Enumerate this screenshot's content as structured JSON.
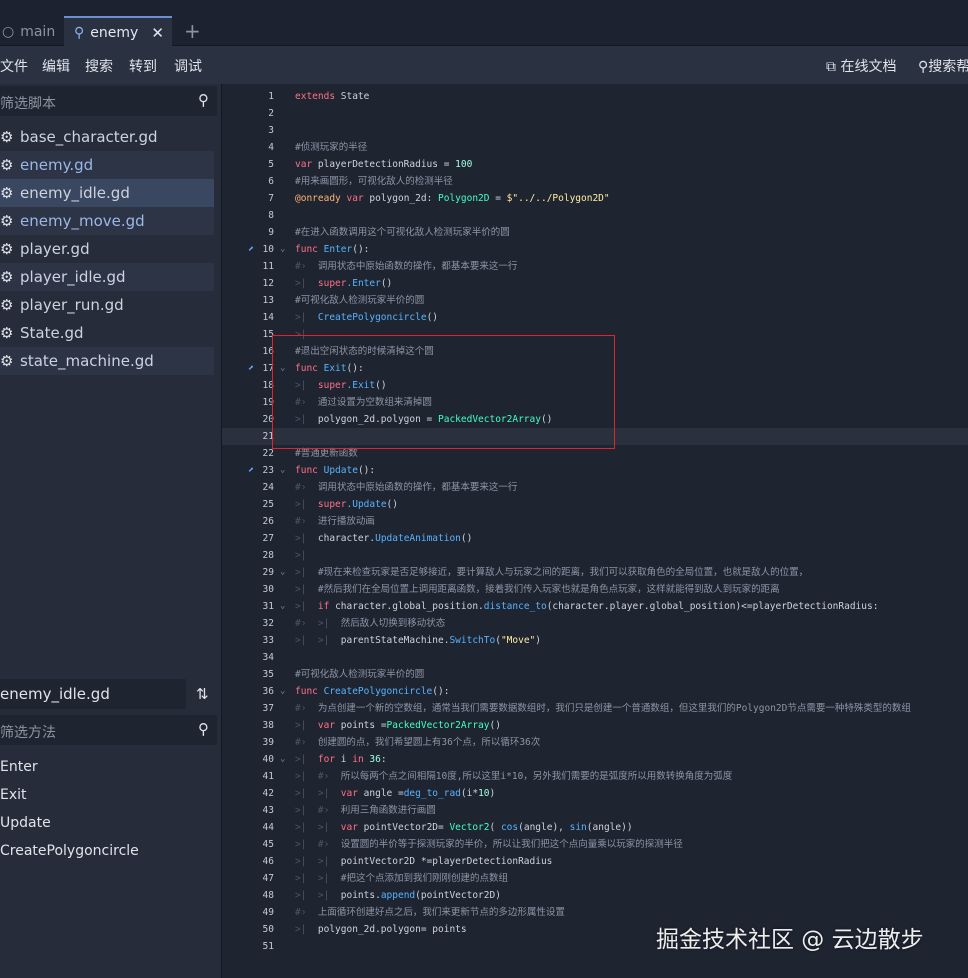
{
  "tabs": {
    "main": "main",
    "enemy": "enemy"
  },
  "menu": {
    "file": "文件",
    "edit": "编辑",
    "search": "搜索",
    "goto": "转到",
    "debug": "调试",
    "online_docs": "在线文档",
    "search_help": "搜索帮助"
  },
  "script_filter": {
    "placeholder": "筛选脚本"
  },
  "scripts": [
    "base_character.gd",
    "enemy.gd",
    "enemy_idle.gd",
    "enemy_move.gd",
    "player.gd",
    "player_idle.gd",
    "player_run.gd",
    "State.gd",
    "state_machine.gd"
  ],
  "current_file": "enemy_idle.gd",
  "method_filter": {
    "placeholder": "筛选方法"
  },
  "methods": [
    "Enter",
    "Exit",
    "Update",
    "CreatePolygoncircle"
  ],
  "line_numbers": [
    "1",
    "2",
    "3",
    "4",
    "5",
    "6",
    "7",
    "8",
    "9",
    "10",
    "11",
    "12",
    "13",
    "14",
    "15",
    "16",
    "17",
    "18",
    "19",
    "20",
    "21",
    "22",
    "23",
    "24",
    "25",
    "26",
    "27",
    "28",
    "29",
    "30",
    "31",
    "32",
    "33",
    "34",
    "35",
    "36",
    "37",
    "38",
    "39",
    "40",
    "41",
    "42",
    "43",
    "44",
    "45",
    "46",
    "47",
    "48",
    "49",
    "50",
    "51"
  ],
  "code": {
    "l1": [
      "extends",
      " State"
    ],
    "l4": "#侦测玩家的半径",
    "l5": [
      "var",
      " playerDetectionRadius = ",
      "100"
    ],
    "l6": "#用来画圆形，可视化敌人的检测半径",
    "l7": [
      "@onready",
      " var",
      " polygon_2d: ",
      "Polygon2D",
      " = ",
      "$\"../../Polygon2D\""
    ],
    "l9": "#在进入函数调用这个可视化敌人检测玩家半价的圆",
    "l10": [
      "func",
      " Enter",
      "():"
    ],
    "l11": "调用状态中原始函数的操作，都基本要来这一行",
    "l12": [
      "super",
      ".Enter",
      "()"
    ],
    "l13": "#可视化敌人检测玩家半价的圆",
    "l14": [
      "CreatePolygoncircle",
      "()"
    ],
    "l16": "#退出空闲状态的时候清掉这个圆",
    "l17": [
      "func",
      " Exit",
      "():"
    ],
    "l18": [
      "super",
      ".Exit",
      "()"
    ],
    "l19": "通过设置为空数组来清掉圆",
    "l20": [
      "polygon_2d.polygon = ",
      "PackedVector2Array",
      "()"
    ],
    "l22": "#普通更新函数",
    "l23": [
      "func",
      " Update",
      "():"
    ],
    "l24": "调用状态中原始函数的操作，都基本要来这一行",
    "l25": [
      "super",
      ".Update",
      "()"
    ],
    "l26": "进行播放动画",
    "l27": [
      "character.",
      "UpdateAnimation",
      "()"
    ],
    "l29": "#现在来检查玩家是否足够接近，要计算敌人与玩家之间的距离，我们可以获取角色的全局位置，也就是敌人的位置，",
    "l30": "#然后我们在全局位置上调用距离函数，接着我们传入玩家也就是角色点玩家，这样就能得到敌人到玩家的距离",
    "l31": [
      "if",
      " character.global_position.",
      "distance_to",
      "(character.player.global_position)<=playerDetectionRadius:"
    ],
    "l32": "然后敌人切换到移动状态",
    "l33": [
      "parentStateMachine.",
      "SwitchTo",
      "(",
      "\"Move\"",
      ")"
    ],
    "l35": "#可视化敌人检测玩家半价的圆",
    "l36": [
      "func",
      " CreatePolygoncircle",
      "():"
    ],
    "l37": "为点创建一个新的空数组，通常当我们需要数据数组时，我们只是创建一个普通数组，但这里我们的Polygon2D节点需要一种特殊类型的数组",
    "l38": [
      "var",
      " points =",
      "PackedVector2Array",
      "()"
    ],
    "l39": "创建圆的点，我们希望圆上有36个点，所以循环36次",
    "l40": [
      "for",
      " i ",
      "in",
      " ",
      "36",
      ":"
    ],
    "l41": "所以每两个点之间相隔10度,所以这里i*10，另外我们需要的是弧度所以用数转换角度为弧度",
    "l42": [
      "var",
      " angle =",
      "deg_to_rad",
      "(i*",
      "10",
      ")"
    ],
    "l43": "利用三角函数进行画圆",
    "l44": [
      "var",
      " pointVector2D= ",
      "Vector2",
      "( ",
      "cos",
      "(angle), ",
      "sin",
      "(angle))"
    ],
    "l45": "设置圆的半价等于探测玩家的半价，所以让我们把这个点向量乘以玩家的探测半径",
    "l46": [
      "pointVector2D *=playerDetectionRadius"
    ],
    "l47": "#把这个点添加到我们刚刚创建的点数组",
    "l48": [
      "points.",
      "append",
      "(pointVector2D)"
    ],
    "l49": "上面循环创建好点之后，我们来更新节点的多边形属性设置",
    "l50": [
      "polygon_2d.polygon= points"
    ]
  },
  "watermark": "掘金技术社区 @ 云边散步",
  "colors": {
    "accent": "#6a8fd4",
    "keyword": "#ff7085",
    "function": "#57b3ff",
    "comment": "#8d95a5",
    "string": "#ffeda1",
    "number": "#a1ffe0",
    "type": "#42ffc2",
    "annotation": "#ffb373",
    "highlight_box": "#e0242b"
  }
}
